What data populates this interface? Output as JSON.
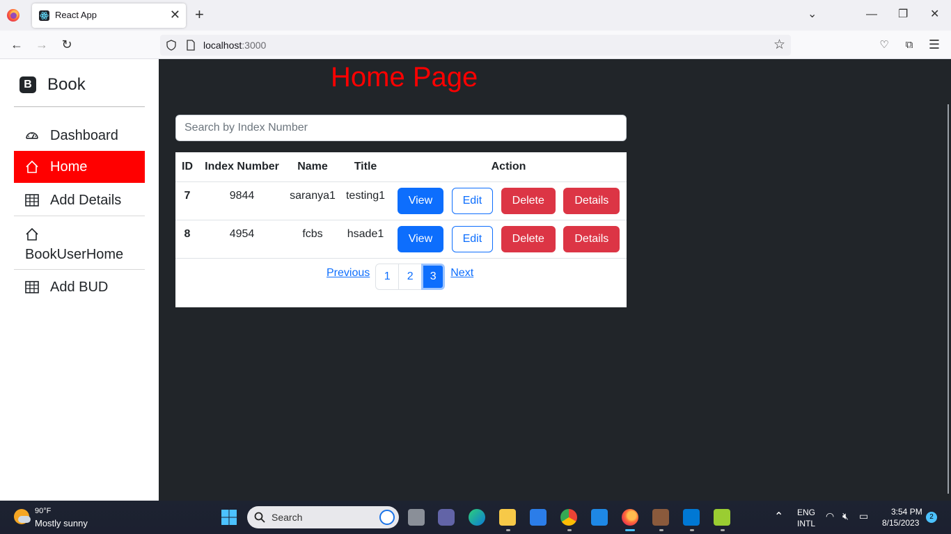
{
  "browser": {
    "tab_title": "React App",
    "url_host": "localhost",
    "url_port": ":3000"
  },
  "sidebar": {
    "brand_letter": "B",
    "brand": "Book",
    "items": [
      {
        "label": "Dashboard",
        "icon": "speedometer-icon",
        "active": false
      },
      {
        "label": "Home",
        "icon": "house-icon",
        "active": true
      },
      {
        "label": "Add Details",
        "icon": "table-icon",
        "active": false
      },
      {
        "label": "BookUserHome",
        "icon": "house-icon",
        "active": false
      },
      {
        "label": "Add BUD",
        "icon": "table-icon",
        "active": false
      }
    ]
  },
  "main": {
    "title": "Home Page",
    "search_placeholder": "Search by Index Number",
    "table": {
      "headers": [
        "ID",
        "Index Number",
        "Name",
        "Title",
        "Action"
      ],
      "rows": [
        {
          "id": "7",
          "index": "9844",
          "name": "saranya1",
          "title": "testing1"
        },
        {
          "id": "8",
          "index": "4954",
          "name": "fcbs",
          "title": "hsade1"
        }
      ],
      "actions": [
        "View",
        "Edit",
        "Delete",
        "Details"
      ]
    },
    "pagination": {
      "previous": "Previous",
      "next": "Next",
      "pages": [
        "1",
        "2",
        "3"
      ],
      "active_page": "3"
    }
  },
  "taskbar": {
    "temp": "90°F",
    "condition": "Mostly sunny",
    "search": "Search",
    "lang1": "ENG",
    "lang2": "INTL",
    "time": "3:54 PM",
    "date": "8/15/2023",
    "notifications": "2"
  },
  "colors": {
    "accent_red": "#ff0000",
    "primary": "#0d6efd",
    "danger": "#dc3545",
    "page_bg": "#212529"
  }
}
